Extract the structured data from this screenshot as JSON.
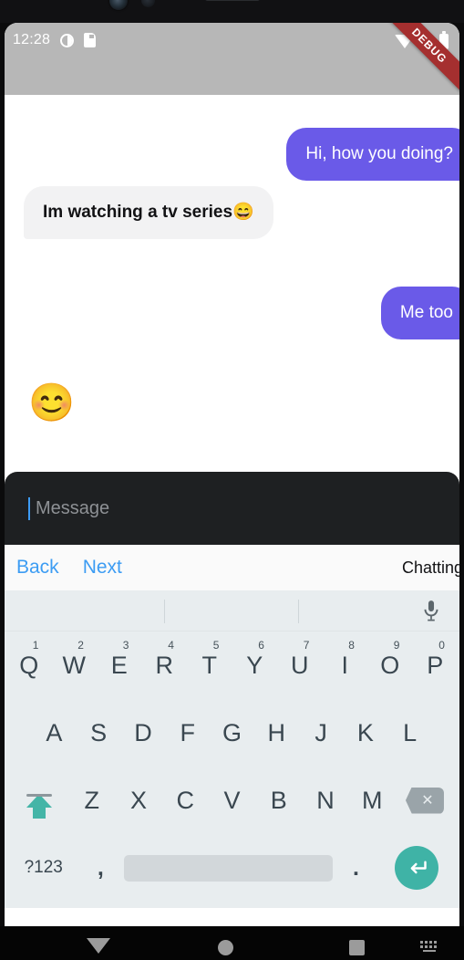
{
  "status_bar": {
    "time": "12:28",
    "icons": [
      "dnd-icon",
      "sd-card-icon",
      "wifi-icon",
      "signal-icon",
      "battery-icon"
    ]
  },
  "debug_banner": {
    "label": "DEBUG",
    "color": "#a52f2f"
  },
  "theme": {
    "outgoing_bubble": "#6a5ae8",
    "incoming_bubble": "#f2f2f3",
    "accent_blue": "#3c9cf3",
    "keyboard_accent": "#3fb3a6",
    "input_background": "#1e2022"
  },
  "conversation": {
    "messages": [
      {
        "text": "Hi, how you doing?",
        "direction": "outgoing",
        "type": "text"
      },
      {
        "text": "Im watching a tv series😄",
        "direction": "incoming",
        "type": "text"
      },
      {
        "text": "Me too",
        "direction": "outgoing",
        "type": "text"
      },
      {
        "text": "😊",
        "direction": "incoming",
        "type": "emoji"
      }
    ]
  },
  "message_input": {
    "value": "",
    "placeholder": "Message"
  },
  "accessory_bar": {
    "back_label": "Back",
    "next_label": "Next",
    "title": "Chatting"
  },
  "keyboard": {
    "suggestions": [
      "",
      "",
      ""
    ],
    "mic_icon": "microphone-icon",
    "rows": {
      "row1": [
        {
          "key": "Q",
          "alt": "1"
        },
        {
          "key": "W",
          "alt": "2"
        },
        {
          "key": "E",
          "alt": "3"
        },
        {
          "key": "R",
          "alt": "4"
        },
        {
          "key": "T",
          "alt": "5"
        },
        {
          "key": "Y",
          "alt": "6"
        },
        {
          "key": "U",
          "alt": "7"
        },
        {
          "key": "I",
          "alt": "8"
        },
        {
          "key": "O",
          "alt": "9"
        },
        {
          "key": "P",
          "alt": "0"
        }
      ],
      "row2": [
        "A",
        "S",
        "D",
        "F",
        "G",
        "H",
        "J",
        "K",
        "L"
      ],
      "row3": [
        "Z",
        "X",
        "C",
        "V",
        "B",
        "N",
        "M"
      ],
      "row4": {
        "symbols_label": "?123",
        "comma": ",",
        "space": "",
        "period": ".",
        "enter": "↵"
      }
    },
    "shift_state": "caps-locked"
  },
  "nav_bar": {
    "items": [
      "hide-keyboard-icon",
      "home-icon",
      "recents-icon",
      "keyboard-switcher-icon"
    ]
  }
}
